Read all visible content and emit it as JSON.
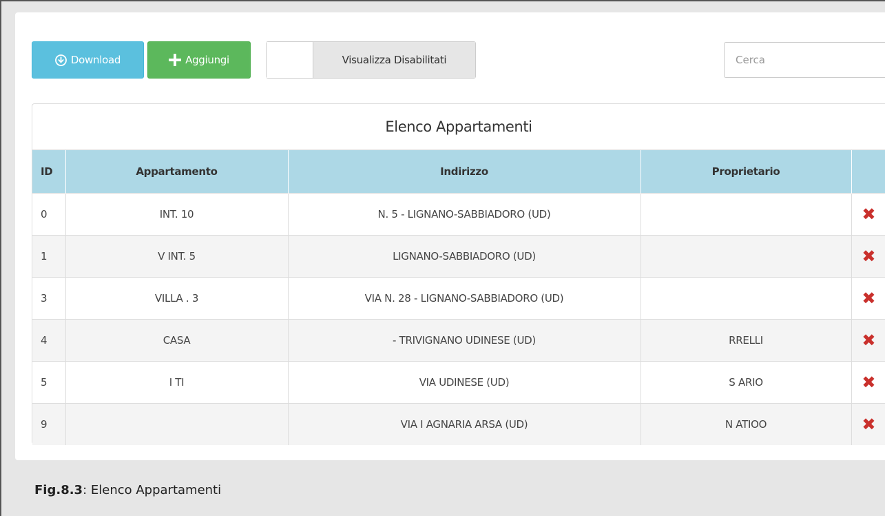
{
  "toolbar": {
    "download_label": "Download",
    "add_label": "Aggiungi",
    "show_disabled_label": "Visualizza Disabilitati",
    "search_placeholder": "Cerca"
  },
  "table": {
    "caption": "Elenco Appartamenti",
    "headers": {
      "id": "ID",
      "apartment": "Appartamento",
      "address": "Indirizzo",
      "owner": "Proprietario",
      "actions": ""
    },
    "rows": [
      {
        "id": "0",
        "apartment": "INT. 10",
        "address": "N. 5 - LIGNANO-SABBIADORO (UD)",
        "owner": ""
      },
      {
        "id": "1",
        "apartment": "V INT. 5",
        "address": "LIGNANO-SABBIADORO (UD)",
        "owner": ""
      },
      {
        "id": "3",
        "apartment": "VILLA . 3",
        "address": "VIA N. 28 - LIGNANO-SABBIADORO (UD)",
        "owner": ""
      },
      {
        "id": "4",
        "apartment": "CASA",
        "address": "- TRIVIGNANO UDINESE (UD)",
        "owner": "RRELLI"
      },
      {
        "id": "5",
        "apartment": "I TI",
        "address": "VIA UDINESE (UD)",
        "owner": "S ARIO"
      },
      {
        "id": "9",
        "apartment": "",
        "address": "VIA I AGNARIA ARSA (UD)",
        "owner": "N ATIOO"
      }
    ],
    "delete_symbol": "✖"
  },
  "figure_caption": {
    "label": "Fig.8.3",
    "text": ": Elenco Appartamenti"
  },
  "colors": {
    "download": "#5bc0de",
    "add": "#5cb85c",
    "header_bg": "#add8e6",
    "delete": "#c9302c"
  }
}
